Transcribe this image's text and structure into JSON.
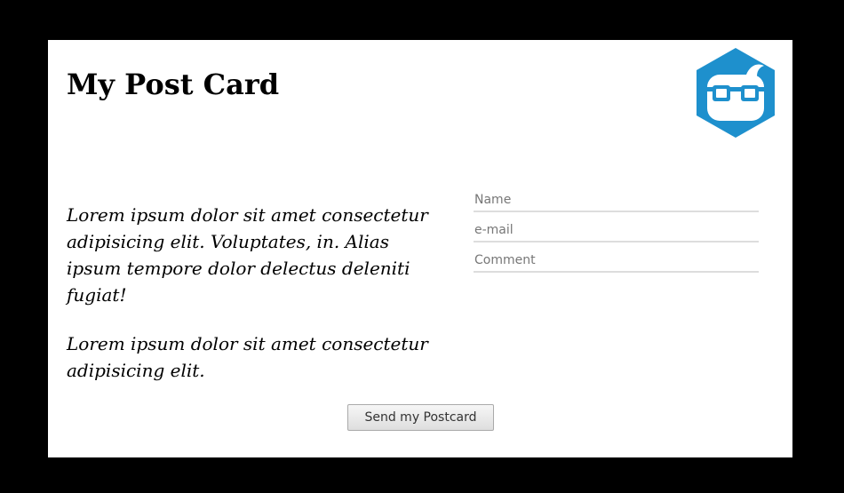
{
  "card": {
    "title": "My Post Card",
    "logo_icon": "glasses-face-hexagon-logo",
    "brand_color": "#1e90cd"
  },
  "message": {
    "paragraphs": [
      "Lorem ipsum dolor sit amet consectetur adipisicing elit. Voluptates, in. Alias ipsum tempore dolor delectus deleniti fugiat!",
      "Lorem ipsum dolor sit amet consectetur adipisicing elit."
    ]
  },
  "form": {
    "name_placeholder": "Name",
    "email_placeholder": "e-mail",
    "comment_placeholder": "Comment",
    "name_value": "",
    "email_value": "",
    "comment_value": ""
  },
  "actions": {
    "send_label": "Send my Postcard"
  }
}
